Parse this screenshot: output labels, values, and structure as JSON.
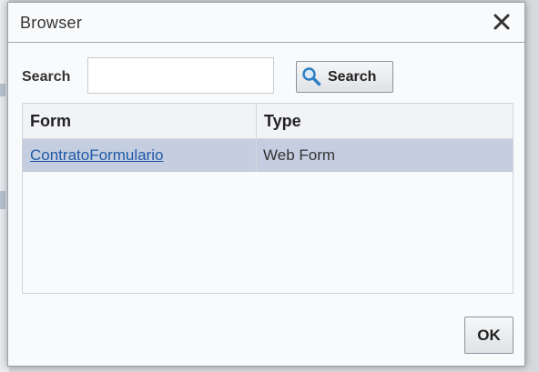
{
  "dialog": {
    "title": "Browser",
    "close_icon": "close-icon"
  },
  "search": {
    "label": "Search",
    "input_value": "",
    "placeholder": "",
    "button_label": "Search",
    "button_icon": "magnifier-icon"
  },
  "table": {
    "columns": [
      "Form",
      "Type"
    ],
    "rows": [
      {
        "form": "ContratoFormulario",
        "type": "Web Form"
      }
    ],
    "selected_row": 0
  },
  "footer": {
    "ok_label": "OK"
  },
  "colors": {
    "selected_row": "#c5cee1",
    "link": "#1f5aa6",
    "header_border": "#9ca6b4"
  }
}
